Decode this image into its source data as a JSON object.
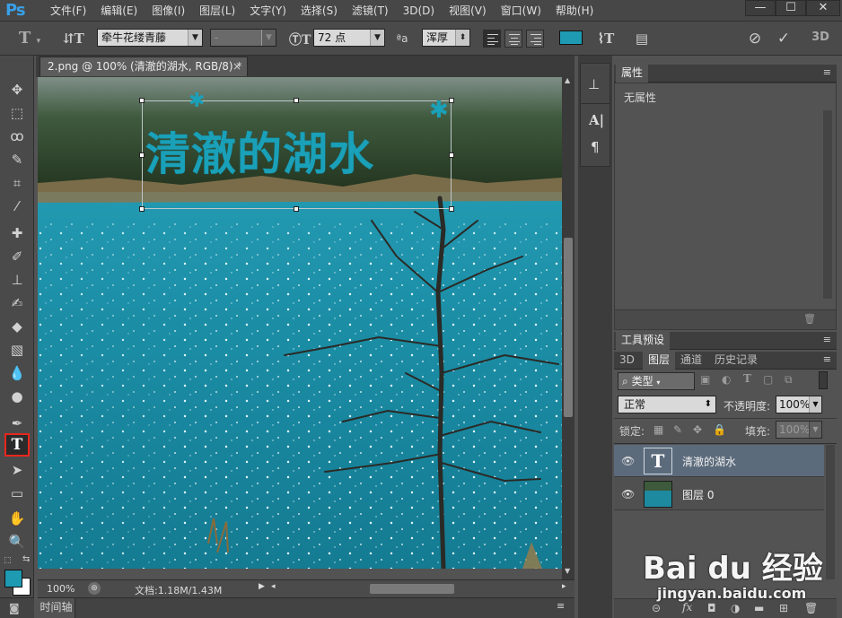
{
  "app": {
    "logo": "Ps"
  },
  "menu": [
    "文件(F)",
    "编辑(E)",
    "图像(I)",
    "图层(L)",
    "文字(Y)",
    "选择(S)",
    "滤镜(T)",
    "3D(D)",
    "视图(V)",
    "窗口(W)",
    "帮助(H)"
  ],
  "window_controls": {
    "minimize": "—",
    "restore": "☐",
    "close": "✕"
  },
  "options": {
    "font_family": "牵牛花缕青藤",
    "font_style": "-",
    "font_size": "72 点",
    "aa_label": "ªa",
    "antialias": "浑厚",
    "text_color": "#1e9ab2",
    "label_3d": "3D"
  },
  "document": {
    "tab_title": "2.png @ 100% (清澈的湖水, RGB/8) *",
    "overlay_text": "清澈的湖水",
    "zoom": "100%",
    "doc_info": "文档:1.18M/1.43M"
  },
  "timeline": {
    "label": "时间轴"
  },
  "properties": {
    "tab": "属性",
    "body": "无属性"
  },
  "tool_presets": {
    "tab": "工具预设"
  },
  "layers_panel": {
    "tabs": [
      "3D",
      "图层",
      "通道",
      "历史记录"
    ],
    "filter": "类型",
    "blend_mode": "正常",
    "opacity_label": "不透明度:",
    "opacity": "100%",
    "lock_label": "锁定:",
    "fill_label": "填充:",
    "fill": "100%",
    "layers": [
      {
        "name": "清澈的湖水",
        "kind": "text",
        "selected": true
      },
      {
        "name": "图层 0",
        "kind": "image",
        "selected": false
      }
    ]
  },
  "watermark": {
    "brand": "Bai du 经验",
    "url": "jingyan.baidu.com"
  },
  "colors": {
    "accent": "#1e9ab2",
    "highlight": "#e8271d",
    "selected_layer": "#5c6b7c"
  }
}
